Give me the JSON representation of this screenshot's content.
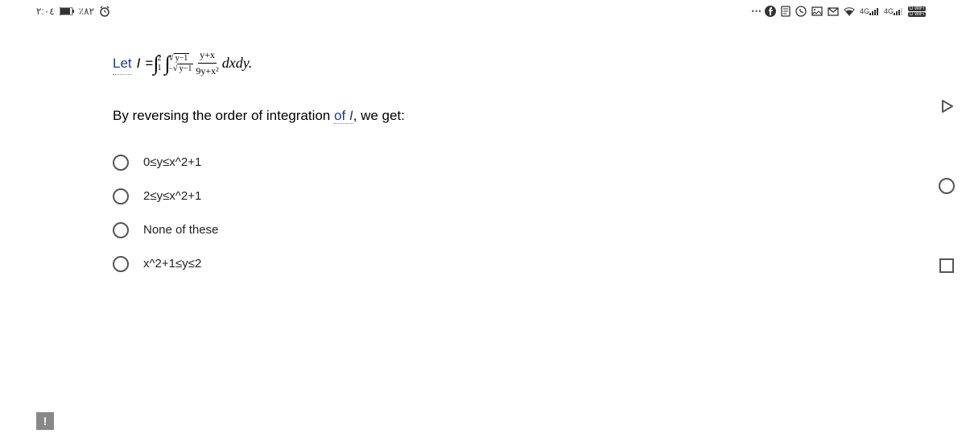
{
  "status": {
    "time": "٢:٠٤",
    "battery_text": "٪٨٢",
    "signal_label": "4G",
    "wifi_label": "WiFi"
  },
  "question": {
    "let_label": "Let",
    "equals": " = ",
    "integral_outer_lower": "1",
    "integral_outer_upper": "2",
    "integral_inner_lower": "−√(y−1)",
    "integral_inner_upper": "√(y−1)",
    "integrand_num": "y+x",
    "integrand_den": "9y+x²",
    "diff": "dxdy.",
    "prompt_before": "By reversing the order of integration ",
    "prompt_of": "of ",
    "prompt_i": "I",
    "prompt_after": ", we get:"
  },
  "options": [
    {
      "label": "0≤y≤x^2+1"
    },
    {
      "label": "2≤y≤x^2+1"
    },
    {
      "label": "None of these"
    },
    {
      "label": "x^2+1≤y≤2"
    }
  ],
  "icons": {
    "more": "⋯",
    "alert": "!"
  }
}
